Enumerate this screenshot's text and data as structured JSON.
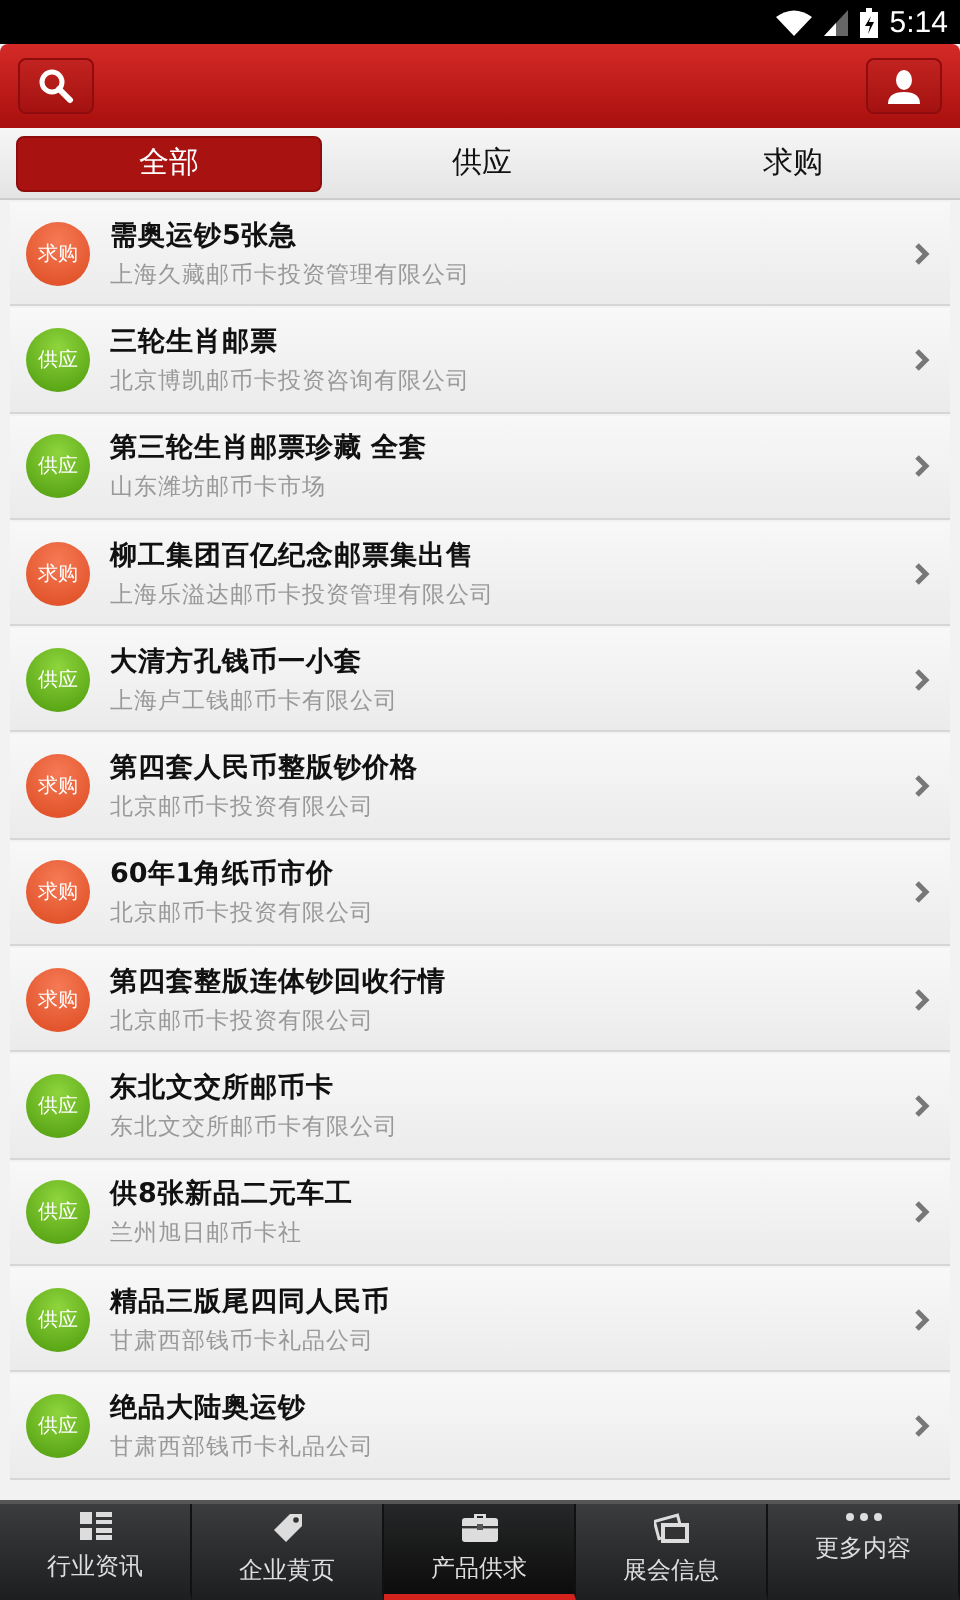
{
  "status_bar": {
    "time": "5:14"
  },
  "tabs": [
    {
      "label": "全部",
      "selected": true
    },
    {
      "label": "供应",
      "selected": false
    },
    {
      "label": "求购",
      "selected": false
    }
  ],
  "items": [
    {
      "kind": "buy",
      "badge": "求购",
      "title": "需奥运钞5张急",
      "company": "上海久藏邮币卡投资管理有限公司"
    },
    {
      "kind": "supply",
      "badge": "供应",
      "title": "三轮生肖邮票",
      "company": "北京博凯邮币卡投资咨询有限公司"
    },
    {
      "kind": "supply",
      "badge": "供应",
      "title": "第三轮生肖邮票珍藏 全套",
      "company": "山东潍坊邮币卡市场"
    },
    {
      "kind": "buy",
      "badge": "求购",
      "title": "柳工集团百亿纪念邮票集出售",
      "company": "上海乐溢达邮币卡投资管理有限公司"
    },
    {
      "kind": "supply",
      "badge": "供应",
      "title": "大清方孔钱币一小套",
      "company": "上海卢工钱邮币卡有限公司"
    },
    {
      "kind": "buy",
      "badge": "求购",
      "title": "第四套人民币整版钞价格",
      "company": "北京邮币卡投资有限公司"
    },
    {
      "kind": "buy",
      "badge": "求购",
      "title": "60年1角纸币市价",
      "company": "北京邮币卡投资有限公司"
    },
    {
      "kind": "buy",
      "badge": "求购",
      "title": "第四套整版连体钞回收行情",
      "company": "北京邮币卡投资有限公司"
    },
    {
      "kind": "supply",
      "badge": "供应",
      "title": "东北文交所邮币卡",
      "company": "东北文交所邮币卡有限公司"
    },
    {
      "kind": "supply",
      "badge": "供应",
      "title": "供8张新品二元车工",
      "company": "兰州旭日邮币卡社"
    },
    {
      "kind": "supply",
      "badge": "供应",
      "title": "精品三版尾四同人民币",
      "company": "甘肃西部钱币卡礼品公司"
    },
    {
      "kind": "supply",
      "badge": "供应",
      "title": "绝品大陆奥运钞",
      "company": "甘肃西部钱币卡礼品公司"
    }
  ],
  "bottom_nav": [
    {
      "kind": "grid",
      "label": "行业资讯",
      "selected": false
    },
    {
      "kind": "tag",
      "label": "企业黄页",
      "selected": false
    },
    {
      "kind": "briefcase",
      "label": "产品供求",
      "selected": true
    },
    {
      "kind": "photos",
      "label": "展会信息",
      "selected": false
    },
    {
      "kind": "more",
      "label": "更多内容",
      "selected": false
    }
  ]
}
